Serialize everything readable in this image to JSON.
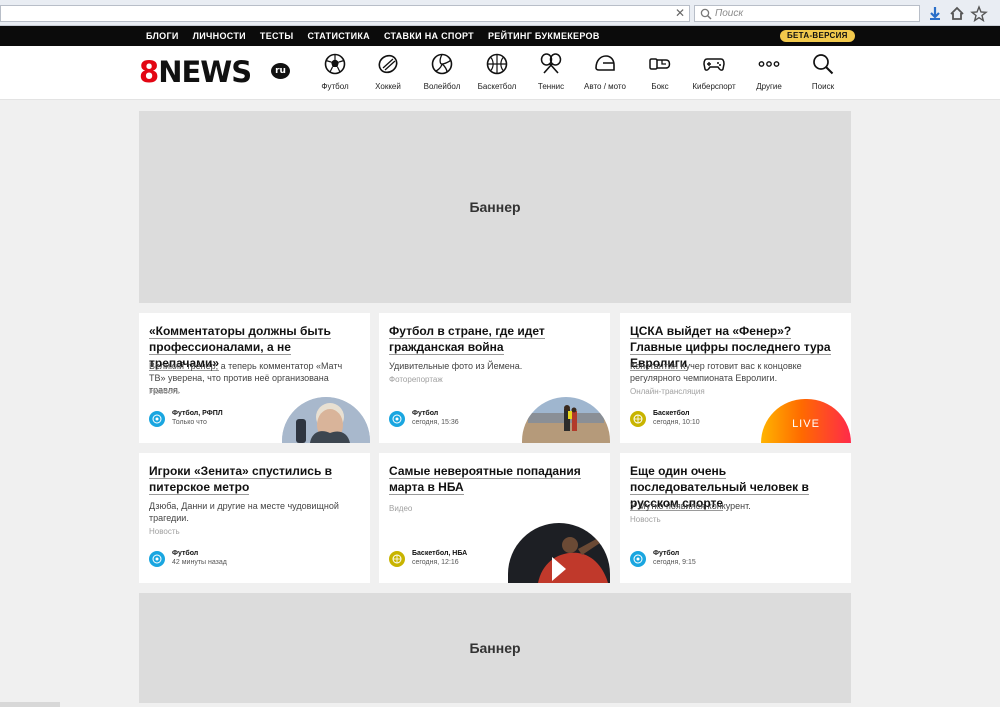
{
  "browser": {
    "search_placeholder": "Поиск",
    "clear_glyph": "✕"
  },
  "topnav": {
    "items": [
      "БЛОГИ",
      "ЛИЧНОСТИ",
      "ТЕСТЫ",
      "СТАТИСТИКА",
      "СТАВКИ НА СПОРТ",
      "РЕЙТИНГ БУКМЕКЕРОВ"
    ],
    "beta_label": "БЕТА-ВЕРСИЯ"
  },
  "logo": {
    "eight": "8",
    "news": "NEWS",
    "ru": "ru"
  },
  "sports": [
    {
      "label": "Футбол",
      "icon": "football-icon"
    },
    {
      "label": "Хоккей",
      "icon": "hockey-icon"
    },
    {
      "label": "Волейбол",
      "icon": "volleyball-icon"
    },
    {
      "label": "Баскетбол",
      "icon": "basketball-icon"
    },
    {
      "label": "Теннис",
      "icon": "tennis-icon"
    },
    {
      "label": "Авто / мото",
      "icon": "helmet-icon"
    },
    {
      "label": "Бокс",
      "icon": "boxing-icon"
    },
    {
      "label": "Киберспорт",
      "icon": "gamepad-icon"
    },
    {
      "label": "Другие",
      "icon": "more-icon"
    },
    {
      "label": "Поиск",
      "icon": "search-icon"
    }
  ],
  "banners": {
    "top": "Баннер",
    "bottom": "Баннер"
  },
  "colors": {
    "football": "#1aa6e0",
    "basketball": "#c8b400",
    "live": "#ff5a1a",
    "logo_red": "#e30613"
  },
  "cards": [
    {
      "title": "«Комментаторы должны быть профессионалами, а не трепачами»",
      "desc": "Великий тренер, а теперь комментатор «Матч ТВ» уверена, что против неё организована травля.",
      "kind": "Новость",
      "category": "Футбол, РФПЛ",
      "time": "Только что"
    },
    {
      "title": "Футбол в стране, где идет гражданская война",
      "desc": "Удивительные фото из Йемена.",
      "kind": "Фоторепортаж",
      "category": "Футбол",
      "time": "сегодня, 15:36"
    },
    {
      "title": "ЦСКА выйдет на «Фенер»? Главные цифры последнего тура Евролиги",
      "desc": "Константин Кучер готовит вас к концовке регулярного чемпионата Евролиги.",
      "kind": "Онлайн-трансляция",
      "category": "Баскетбол",
      "time": "сегодня, 10:10",
      "live": "LIVE"
    },
    {
      "title": "Игроки «Зенита» спустились в питерское метро",
      "desc": "Дзюба, Данни и другие на месте чудовищной трагедии.",
      "kind": "Новость",
      "category": "Футбол",
      "time": "42 минуты назад"
    },
    {
      "title": "Самые невероятные попадания марта в НБА",
      "desc": "",
      "kind": "Видео",
      "category": "Баскетбол, НБА",
      "time": "сегодня, 12:16"
    },
    {
      "title": "Еще один очень последовательный человек в русском спорте",
      "desc": "У Мутко появился конкурент.",
      "kind": "Новость",
      "category": "Футбол",
      "time": "сегодня, 9:15"
    }
  ]
}
